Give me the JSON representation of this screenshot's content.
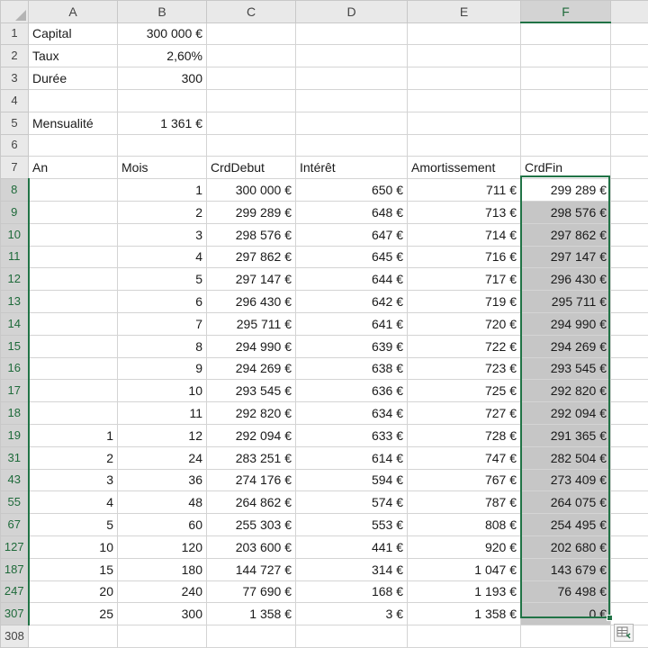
{
  "columns": [
    "A",
    "B",
    "C",
    "D",
    "E",
    "F"
  ],
  "selection": {
    "column": "F",
    "rows": [
      8,
      307
    ]
  },
  "inputs": [
    {
      "row": "1",
      "label": "Capital",
      "value": "300 000 €"
    },
    {
      "row": "2",
      "label": "Taux",
      "value": "2,60%"
    },
    {
      "row": "3",
      "label": "Durée",
      "value": "300"
    },
    {
      "row": "4",
      "label": "",
      "value": ""
    },
    {
      "row": "5",
      "label": "Mensualité",
      "value": "1 361 €"
    },
    {
      "row": "6",
      "label": "",
      "value": ""
    }
  ],
  "header_row": {
    "row": "7",
    "cells": [
      "An",
      "Mois",
      "CrdDebut",
      "Intérêt",
      "Amortissement",
      "CrdFin"
    ]
  },
  "rows": [
    {
      "row": "8",
      "cells": [
        "",
        "1",
        "300 000 €",
        "650 €",
        "711 €",
        "299 289 €"
      ]
    },
    {
      "row": "9",
      "cells": [
        "",
        "2",
        "299 289 €",
        "648 €",
        "713 €",
        "298 576 €"
      ]
    },
    {
      "row": "10",
      "cells": [
        "",
        "3",
        "298 576 €",
        "647 €",
        "714 €",
        "297 862 €"
      ]
    },
    {
      "row": "11",
      "cells": [
        "",
        "4",
        "297 862 €",
        "645 €",
        "716 €",
        "297 147 €"
      ]
    },
    {
      "row": "12",
      "cells": [
        "",
        "5",
        "297 147 €",
        "644 €",
        "717 €",
        "296 430 €"
      ]
    },
    {
      "row": "13",
      "cells": [
        "",
        "6",
        "296 430 €",
        "642 €",
        "719 €",
        "295 711 €"
      ]
    },
    {
      "row": "14",
      "cells": [
        "",
        "7",
        "295 711 €",
        "641 €",
        "720 €",
        "294 990 €"
      ]
    },
    {
      "row": "15",
      "cells": [
        "",
        "8",
        "294 990 €",
        "639 €",
        "722 €",
        "294 269 €"
      ]
    },
    {
      "row": "16",
      "cells": [
        "",
        "9",
        "294 269 €",
        "638 €",
        "723 €",
        "293 545 €"
      ]
    },
    {
      "row": "17",
      "cells": [
        "",
        "10",
        "293 545 €",
        "636 €",
        "725 €",
        "292 820 €"
      ]
    },
    {
      "row": "18",
      "cells": [
        "",
        "11",
        "292 820 €",
        "634 €",
        "727 €",
        "292 094 €"
      ]
    },
    {
      "row": "19",
      "cells": [
        "1",
        "12",
        "292 094 €",
        "633 €",
        "728 €",
        "291 365 €"
      ]
    },
    {
      "row": "31",
      "cells": [
        "2",
        "24",
        "283 251 €",
        "614 €",
        "747 €",
        "282 504 €"
      ]
    },
    {
      "row": "43",
      "cells": [
        "3",
        "36",
        "274 176 €",
        "594 €",
        "767 €",
        "273 409 €"
      ]
    },
    {
      "row": "55",
      "cells": [
        "4",
        "48",
        "264 862 €",
        "574 €",
        "787 €",
        "264 075 €"
      ]
    },
    {
      "row": "67",
      "cells": [
        "5",
        "60",
        "255 303 €",
        "553 €",
        "808 €",
        "254 495 €"
      ]
    },
    {
      "row": "127",
      "cells": [
        "10",
        "120",
        "203 600 €",
        "441 €",
        "920 €",
        "202 680 €"
      ]
    },
    {
      "row": "187",
      "cells": [
        "15",
        "180",
        "144 727 €",
        "314 €",
        "1 047 €",
        "143 679 €"
      ]
    },
    {
      "row": "247",
      "cells": [
        "20",
        "240",
        "77 690 €",
        "168 €",
        "1 193 €",
        "76 498 €"
      ]
    },
    {
      "row": "307",
      "cells": [
        "25",
        "300",
        "1 358 €",
        "3 €",
        "1 358 €",
        "0 €"
      ]
    }
  ],
  "trailing_row": {
    "row": "308"
  },
  "colors": {
    "selection_border": "#217346",
    "selection_fill": "#c6c6c6",
    "header_bg": "#e9e9e9"
  },
  "icons": {
    "quick_analysis": "quick-analysis-icon"
  }
}
